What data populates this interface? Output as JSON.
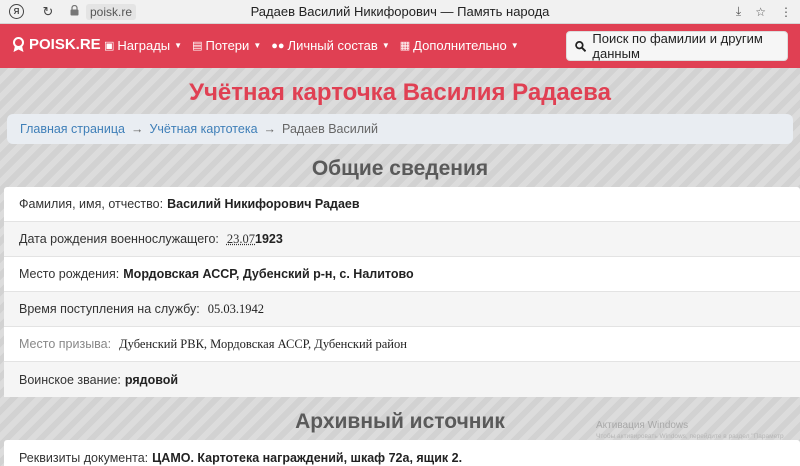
{
  "browser": {
    "url": "poisk.re",
    "tab_title": "Радаев Василий Никифорович — Память народа",
    "brand_letter": "Я"
  },
  "nav": {
    "logo_text": "POISK.RE",
    "items": [
      {
        "label": "Награды",
        "icon": "award-icon"
      },
      {
        "label": "Потери",
        "icon": "book-icon"
      },
      {
        "label": "Личный состав",
        "icon": "users-icon"
      },
      {
        "label": "Дополнительно",
        "icon": "news-icon"
      }
    ],
    "search_label": "Поиск по фамилии и другим данным",
    "brand_color": "#e04053"
  },
  "page": {
    "title": "Учётная карточка Василия Радаева",
    "breadcrumb": [
      "Главная страница",
      "Учётная картотека",
      "Радаев Василий"
    ],
    "breadcrumb_sep": "→"
  },
  "general": {
    "title": "Общие сведения",
    "rows": [
      {
        "label": "Фамилия, имя, отчество:",
        "value": "Василий Никифорович Радаев"
      },
      {
        "label": "Дата рождения военнослужащего:",
        "day": "23.07",
        "year": "1923"
      },
      {
        "label": "Место рождения:",
        "value": "Мордовская АССР, Дубенский р-н, с. Налитово"
      },
      {
        "label": "Время поступления на службу:",
        "value": "05.03.1942"
      },
      {
        "label": "Место призыва:",
        "value": "Дубенский РВК, Мордовская АССР, Дубенский район"
      },
      {
        "label": "Воинское звание:",
        "value": "рядовой"
      }
    ]
  },
  "archive": {
    "title": "Архивный источник",
    "rows": [
      {
        "label": "Реквизиты документа:",
        "value": "ЦАМО. Картотека награждений, шкаф 72а, ящик 2."
      }
    ]
  },
  "watermark": {
    "line1": "Активация Windows",
    "line2": "Чтобы активировать Windows, перейдите в раздел \"Параметр"
  }
}
